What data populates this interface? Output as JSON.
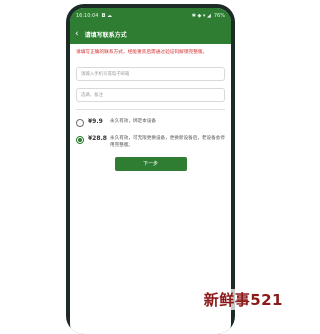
{
  "status_bar": {
    "time": "16:10:04",
    "left_icons": "◘ ☁",
    "right_icons": "✱ ◆ ▾ ◢",
    "battery": "76%"
  },
  "app_bar": {
    "back_icon": "‹",
    "title": "请填写联系方式"
  },
  "notice": "请填写正确的联系方式，经能重装后需通过验证码解锁完整版。",
  "phone_field": {
    "placeholder": "请输入手机号或电子邮箱"
  },
  "remark_field": {
    "placeholder": "选填，备注"
  },
  "options": [
    {
      "price": "¥9.9",
      "desc": "永久有效，绑定本设备",
      "selected": false
    },
    {
      "price": "¥28.8",
      "desc": "永久有效，可无限更换设备，更换新设备后，老设备会停用完整版。",
      "selected": true
    }
  ],
  "next_button": "下一步",
  "watermark": "新鲜事521",
  "colors": {
    "primary": "#2e7d32",
    "notice": "#d32f2f",
    "watermark": "#8b1a1a"
  }
}
